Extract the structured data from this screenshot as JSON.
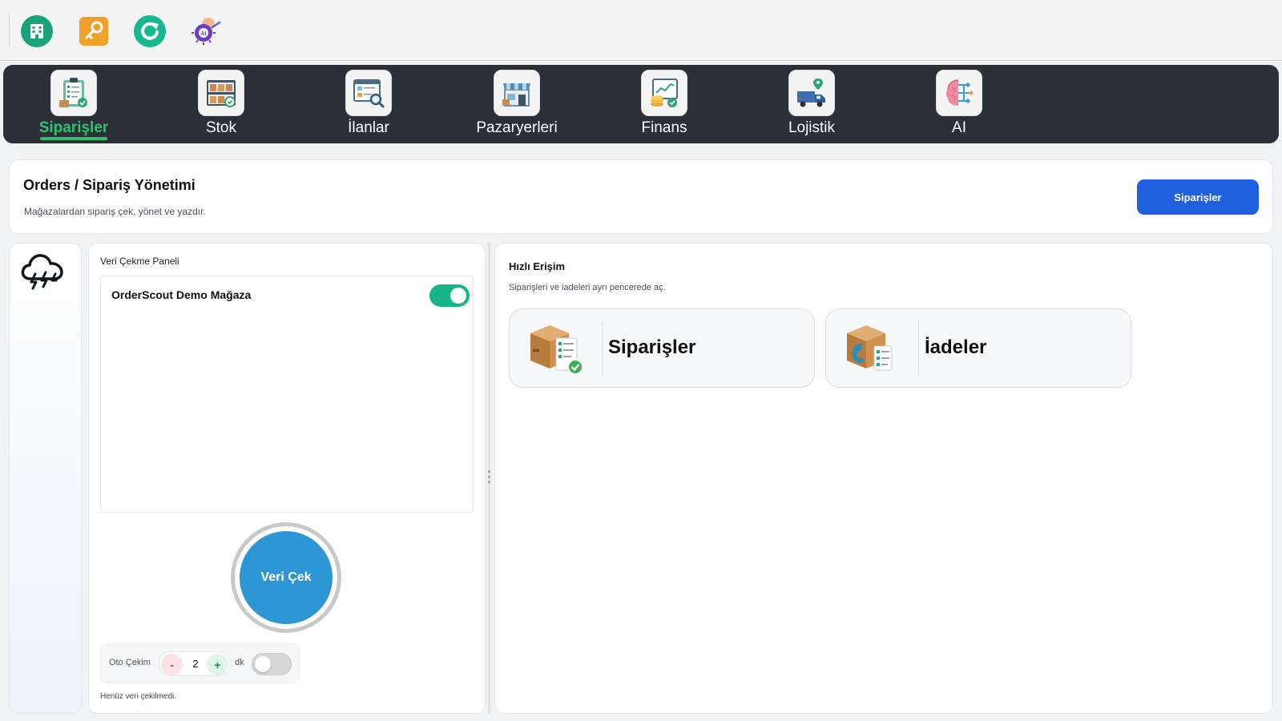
{
  "toolbar": {
    "buttons": [
      {
        "icon": "building-icon",
        "color": "#1aa37a"
      },
      {
        "icon": "key-icon",
        "color": "#f0a12c"
      },
      {
        "icon": "refresh-icon",
        "color": "#17b890"
      },
      {
        "icon": "ai-chip-icon",
        "color": "#6b3fc4"
      }
    ]
  },
  "modules": {
    "active": "Siparişler",
    "active_color": "#2fc36d",
    "items": [
      {
        "label": "Siparişler",
        "icon": "clipboard-checklist-icon"
      },
      {
        "label": "Stok",
        "icon": "warehouse-shelf-icon"
      },
      {
        "label": "İlanlar",
        "icon": "listing-search-icon"
      },
      {
        "label": "Pazaryerleri",
        "icon": "storefront-icon"
      },
      {
        "label": "Finans",
        "icon": "finance-coins-icon"
      },
      {
        "label": "Lojistik",
        "icon": "delivery-truck-icon"
      },
      {
        "label": "AI",
        "icon": "ai-brain-icon"
      }
    ]
  },
  "header": {
    "title": "Orders / Sipariş Yönetimi",
    "subtitle": "Mağazalardan sipariş çek, yönet ve yazdır.",
    "action_label": "Siparişler",
    "action_color": "#1f5fe0"
  },
  "rail": {
    "icon": "cloud-lightning-icon"
  },
  "fetch_panel": {
    "title": "Veri Çekme Paneli",
    "store_name": "OrderScout Demo Mağaza",
    "store_enabled": true,
    "fetch_button": "Veri Çek",
    "fetch_color": "#2f96d6",
    "auto": {
      "label": "Oto Çekim",
      "minus": "-",
      "value": "2",
      "plus": "+",
      "unit": "dk",
      "enabled": false
    },
    "status": "Henüz veri çekilmedi."
  },
  "quick_access": {
    "title": "Hızlı Erişim",
    "subtitle": "Siparişleri ve iadeleri ayrı pencerede aç.",
    "cards": [
      {
        "label": "Siparişler",
        "icon": "order-box-checklist-icon"
      },
      {
        "label": "İadeler",
        "icon": "return-box-icon"
      }
    ]
  }
}
